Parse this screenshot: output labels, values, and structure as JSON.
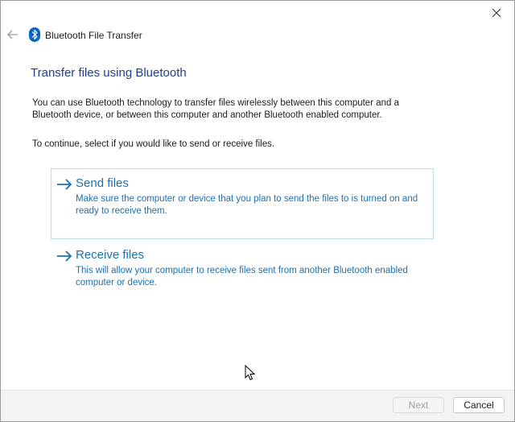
{
  "window": {
    "title": "Bluetooth File Transfer"
  },
  "content": {
    "heading": "Transfer files using Bluetooth",
    "description": "You can use Bluetooth technology to transfer files wirelessly between this computer and a Bluetooth device, or between this computer and another Bluetooth enabled computer.",
    "instruction": "To continue, select if you would like to send or receive files."
  },
  "options": [
    {
      "title": "Send files",
      "description": "Make sure the computer or device that you plan to send the files to is turned on and ready to receive them."
    },
    {
      "title": "Receive files",
      "description": "This will allow your computer to receive files sent from another Bluetooth enabled computer or device."
    }
  ],
  "footer": {
    "next_label": "Next",
    "cancel_label": "Cancel"
  },
  "icons": {
    "close": "close-icon",
    "back": "back-arrow-icon",
    "bluetooth": "bluetooth-icon",
    "option_arrow": "arrow-right-icon"
  },
  "colors": {
    "heading": "#1f3e8a",
    "link": "#1e6fb0",
    "bluetooth_badge": "#0a64c8",
    "hover_border": "#bcdcf0"
  }
}
